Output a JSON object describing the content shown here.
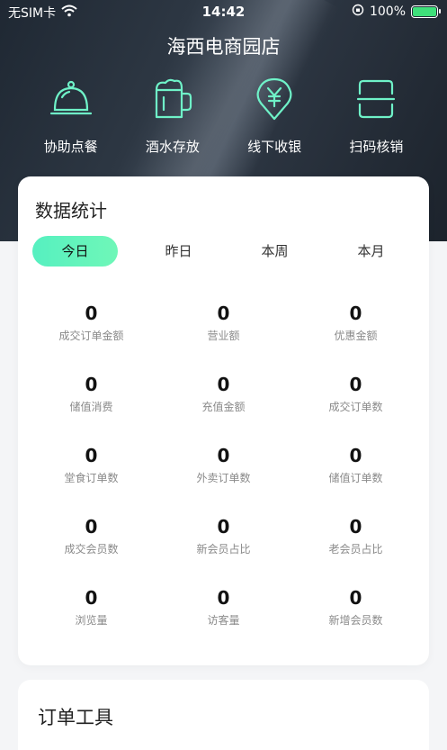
{
  "status_bar": {
    "carrier": "无SIM卡",
    "time": "14:42",
    "battery": "100%",
    "wifi_icon": "wifi-icon",
    "lock_icon": "orientation-lock-icon"
  },
  "store": {
    "title": "海西电商园店"
  },
  "quick_actions": [
    {
      "label": "协助点餐",
      "icon": "cloche-icon"
    },
    {
      "label": "酒水存放",
      "icon": "beer-mug-icon"
    },
    {
      "label": "线下收银",
      "icon": "yuan-pin-icon"
    },
    {
      "label": "扫码核销",
      "icon": "scan-icon"
    }
  ],
  "stats": {
    "title": "数据统计",
    "tabs": [
      "今日",
      "昨日",
      "本周",
      "本月"
    ],
    "active_tab": 0,
    "items": [
      {
        "value": "0",
        "label": "成交订单金额"
      },
      {
        "value": "0",
        "label": "营业额"
      },
      {
        "value": "0",
        "label": "优惠金额"
      },
      {
        "value": "0",
        "label": "储值消费"
      },
      {
        "value": "0",
        "label": "充值金额"
      },
      {
        "value": "0",
        "label": "成交订单数"
      },
      {
        "value": "0",
        "label": "堂食订单数"
      },
      {
        "value": "0",
        "label": "外卖订单数"
      },
      {
        "value": "0",
        "label": "储值订单数"
      },
      {
        "value": "0",
        "label": "成交会员数"
      },
      {
        "value": "0",
        "label": "新会员占比"
      },
      {
        "value": "0",
        "label": "老会员占比"
      },
      {
        "value": "0",
        "label": "浏览量"
      },
      {
        "value": "0",
        "label": "访客量"
      },
      {
        "value": "0",
        "label": "新增会员数"
      }
    ]
  },
  "order_tools": {
    "title": "订单工具"
  },
  "colors": {
    "accent": "#5ff2c0",
    "hero_dark": "#1f2833",
    "icon_stroke": "#6ff2c8"
  }
}
